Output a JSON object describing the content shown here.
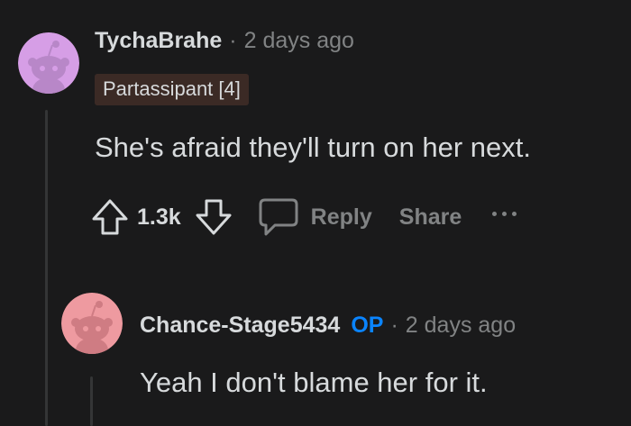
{
  "comment": {
    "author": "TychaBrahe",
    "separator": "·",
    "time": "2 days ago",
    "flair": "Partassipant [4]",
    "body": "She's afraid they'll turn on her next.",
    "avatar_color": "#d69ee6",
    "votes": "1.3k",
    "actions": {
      "reply": "Reply",
      "share": "Share"
    }
  },
  "reply": {
    "author": "Chance-Stage5434",
    "op_label": "OP",
    "separator": "·",
    "time": "2 days ago",
    "body": "Yeah I don't blame her for it.",
    "avatar_color": "#ee9aa0"
  },
  "icons": {
    "upvote": "arrow-up-icon",
    "downvote": "arrow-down-icon",
    "comment": "speech-bubble-icon",
    "more": "ellipsis-icon"
  },
  "colors": {
    "background": "#1a1a1b",
    "text": "#d7dadc",
    "muted": "#818384",
    "op": "#0a84ff",
    "flair_bg": "#3b2a25"
  }
}
